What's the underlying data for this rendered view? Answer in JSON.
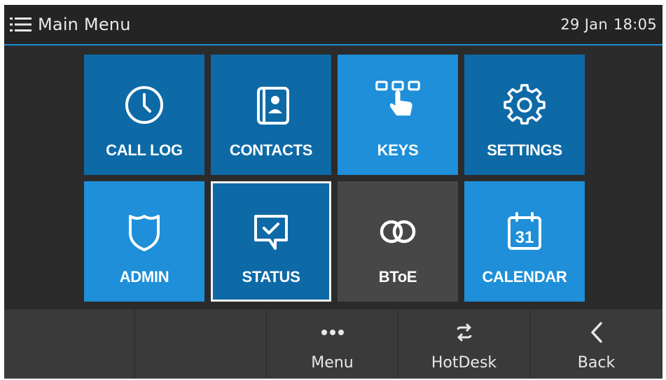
{
  "header": {
    "title": "Main Menu",
    "date": "29 Jan",
    "time": "18:05"
  },
  "tiles": [
    {
      "label": "CALL LOG",
      "icon": "clock-icon"
    },
    {
      "label": "CONTACTS",
      "icon": "contacts-book-icon"
    },
    {
      "label": "KEYS",
      "icon": "keys-touch-icon"
    },
    {
      "label": "SETTINGS",
      "icon": "gear-icon"
    },
    {
      "label": "ADMIN",
      "icon": "shield-icon"
    },
    {
      "label": "STATUS",
      "icon": "status-message-icon",
      "selected": true
    },
    {
      "label": "BToE",
      "icon": "btoe-rings-icon"
    },
    {
      "label": "CALENDAR",
      "icon": "calendar-icon",
      "icon_text": "31"
    }
  ],
  "softkeys": [
    {
      "label": "",
      "icon": ""
    },
    {
      "label": "",
      "icon": ""
    },
    {
      "label": "Menu",
      "icon": "more-dots-icon"
    },
    {
      "label": "HotDesk",
      "icon": "swap-arrows-icon"
    },
    {
      "label": "Back",
      "icon": "chevron-left-icon"
    }
  ],
  "colors": {
    "tile_dark": "#0d6aa7",
    "tile_light": "#1e8fd8",
    "tile_gray": "#474747",
    "header_accent": "#1d8fd6",
    "background": "#2b2b2b"
  }
}
